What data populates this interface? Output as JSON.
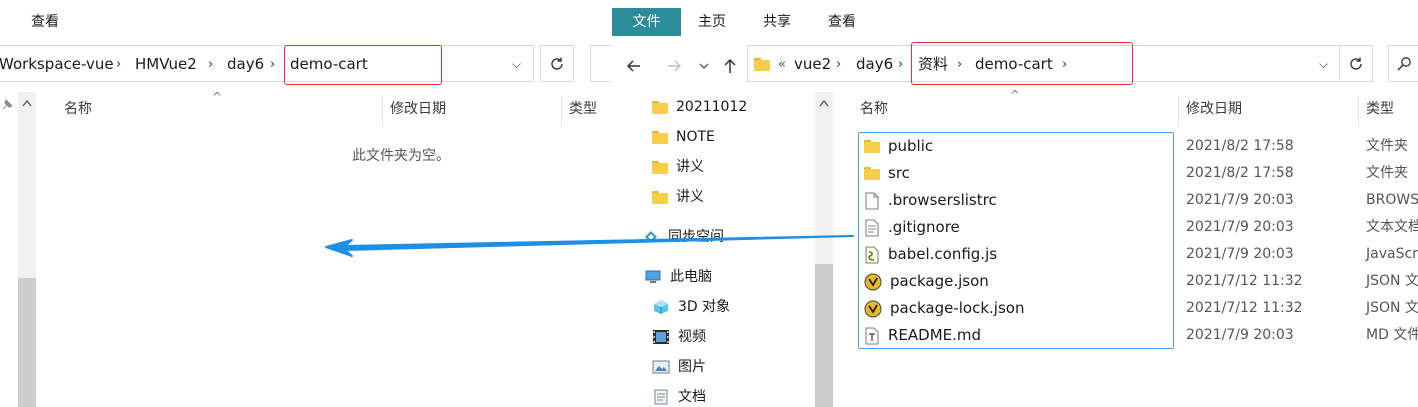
{
  "left": {
    "tabs": [
      "查看"
    ],
    "crumbs": [
      "Workspace-vue",
      "HMVue2",
      "day6",
      "demo-cart"
    ],
    "columns": [
      "名称",
      "修改日期",
      "类型"
    ],
    "empty_message": "此文件夹为空。"
  },
  "right": {
    "tabs": [
      "文件",
      "主页",
      "共享",
      "查看"
    ],
    "crumbs_prefix": "«",
    "crumbs": [
      "vue2",
      "day6",
      "资料",
      "demo-cart"
    ],
    "columns": [
      "名称",
      "修改日期",
      "类型"
    ],
    "nav": [
      {
        "label": "20211012",
        "icon": "folder-icon"
      },
      {
        "label": "NOTE",
        "icon": "folder-icon"
      },
      {
        "label": "讲义",
        "icon": "folder-icon"
      },
      {
        "label": "讲义",
        "icon": "folder-icon"
      },
      {
        "label": "同步空间",
        "icon": "sync-space-icon"
      },
      {
        "label": "此电脑",
        "icon": "this-pc-icon"
      },
      {
        "label": "3D 对象",
        "icon": "3d-objects-icon"
      },
      {
        "label": "视频",
        "icon": "videos-icon"
      },
      {
        "label": "图片",
        "icon": "pictures-icon"
      },
      {
        "label": "文档",
        "icon": "documents-icon"
      }
    ],
    "files": [
      {
        "name": "public",
        "date": "2021/8/2 17:58",
        "type": "文件夹",
        "icon": "folder-icon"
      },
      {
        "name": "src",
        "date": "2021/8/2 17:58",
        "type": "文件夹",
        "icon": "folder-icon"
      },
      {
        "name": ".browserslistrc",
        "date": "2021/7/9 20:03",
        "type": "BROWS",
        "icon": "blank-file-icon"
      },
      {
        "name": ".gitignore",
        "date": "2021/7/9 20:03",
        "type": "文本文档",
        "icon": "text-file-icon"
      },
      {
        "name": "babel.config.js",
        "date": "2021/7/9 20:03",
        "type": "JavaScr",
        "icon": "js-file-icon"
      },
      {
        "name": "package.json",
        "date": "2021/7/12 11:32",
        "type": "JSON 文",
        "icon": "json-file-icon"
      },
      {
        "name": "package-lock.json",
        "date": "2021/7/12 11:32",
        "type": "JSON 文",
        "icon": "json-file-icon"
      },
      {
        "name": "README.md",
        "date": "2021/7/9 20:03",
        "type": "MD 文件",
        "icon": "markdown-file-icon"
      }
    ]
  },
  "colors": {
    "accent_tab": "#2b8c9a",
    "highlight_red": "#e0302d",
    "arrow_blue": "#1e8fe6",
    "selection_blue": "#4a9fe8"
  }
}
